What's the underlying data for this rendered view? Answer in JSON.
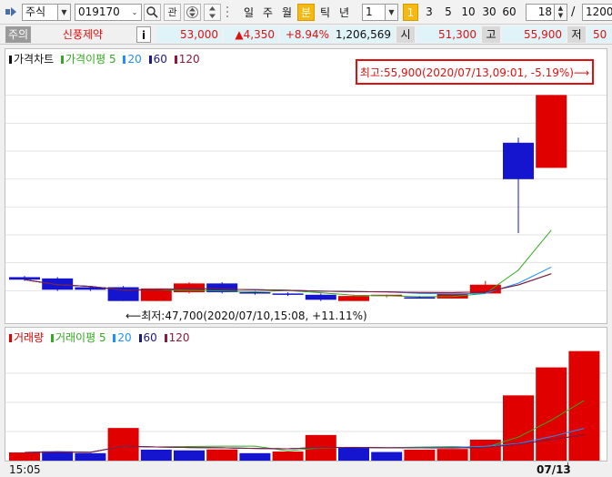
{
  "toolbar": {
    "market": "주식",
    "code": "019170",
    "btn_watch": "관",
    "periods": [
      "일",
      "주",
      "월",
      "분",
      "틱",
      "년"
    ],
    "active_period": "분",
    "interval_value": "1",
    "quick_intervals": [
      "1",
      "3",
      "5",
      "10",
      "30",
      "60"
    ],
    "active_quick_interval": "1",
    "display_count": "18",
    "slash": "/",
    "total_count": "1200"
  },
  "quote": {
    "badge": "주의",
    "name": "신풍제약",
    "info": "i",
    "price": "53,000",
    "change": "▲4,350",
    "change_pct": "+8.94%",
    "volume": "1,206,569",
    "open_label": "시",
    "open": "51,300",
    "high_label": "고",
    "high": "55,900",
    "low_label": "저",
    "low": "50"
  },
  "price_legend": {
    "title": "가격차트",
    "ma_label": "가격이평",
    "ma_periods": [
      "5",
      "20",
      "60",
      "120"
    ]
  },
  "volume_legend": {
    "title": "거래량",
    "ma_label": "거래이평",
    "ma_periods": [
      "5",
      "20",
      "60",
      "120"
    ]
  },
  "annotations": {
    "high_text": "최고:55,900(2020/07/13,09:01, -5.19%)⟶",
    "low_text": "⟵최저:47,700(2020/07/10,15:08, +11.11%)"
  },
  "colors": {
    "up": "#e00000",
    "down": "#1515d0",
    "ma5": "#33aa22",
    "ma20": "#1e90ff",
    "ma60": "#1a1a80",
    "ma120": "#8b1a3a",
    "active": "#f5b90f"
  },
  "xaxis": {
    "start_label": "15:05",
    "end_label": "07/13"
  },
  "chart_data": {
    "type": "candlestick",
    "price_ylim": [
      47000,
      57000
    ],
    "candles": [
      {
        "o": 48650,
        "c": 48550,
        "h": 48700,
        "l": 48500
      },
      {
        "o": 48600,
        "c": 48150,
        "h": 48650,
        "l": 48100
      },
      {
        "o": 48250,
        "c": 48150,
        "h": 48300,
        "l": 48100
      },
      {
        "o": 48250,
        "c": 47700,
        "h": 48300,
        "l": 47700
      },
      {
        "o": 47700,
        "c": 48200,
        "h": 48200,
        "l": 47700
      },
      {
        "o": 48050,
        "c": 48400,
        "h": 48450,
        "l": 48000
      },
      {
        "o": 48400,
        "c": 48050,
        "h": 48450,
        "l": 48000
      },
      {
        "o": 48050,
        "c": 48000,
        "h": 48100,
        "l": 47950
      },
      {
        "o": 48000,
        "c": 47950,
        "h": 48050,
        "l": 47900
      },
      {
        "o": 47950,
        "c": 47750,
        "h": 48000,
        "l": 47700
      },
      {
        "o": 47700,
        "c": 47900,
        "h": 47950,
        "l": 47700
      },
      {
        "o": 47900,
        "c": 47950,
        "h": 47950,
        "l": 47850
      },
      {
        "o": 47850,
        "c": 47800,
        "h": 47900,
        "l": 47800
      },
      {
        "o": 47800,
        "c": 48000,
        "h": 48000,
        "l": 47800
      },
      {
        "o": 48000,
        "c": 48350,
        "h": 48500,
        "l": 48000
      },
      {
        "o": 54000,
        "c": 52550,
        "h": 54200,
        "l": 50400
      },
      {
        "o": 53000,
        "c": 55900,
        "h": 55900,
        "l": 53000
      }
    ],
    "volume_ylim": [
      0,
      50000
    ],
    "volumes": [
      3500,
      4000,
      3200,
      14000,
      4700,
      4400,
      4800,
      3200,
      3900,
      11000,
      5700,
      3700,
      4700,
      5000,
      9000,
      28000,
      40000,
      47000
    ],
    "volume_dirs": [
      "up",
      "down",
      "down",
      "up",
      "down",
      "down",
      "up",
      "down",
      "up",
      "up",
      "down",
      "down",
      "up",
      "up",
      "up",
      "up",
      "up",
      "up"
    ]
  }
}
